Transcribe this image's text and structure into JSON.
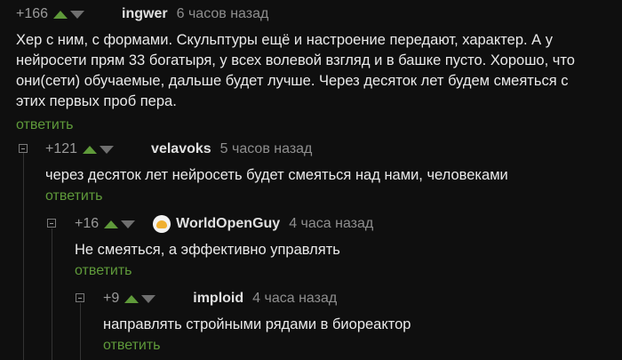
{
  "comments": [
    {
      "rating": "+166",
      "author": "ingwer",
      "time": "6 часов назад",
      "text": "Хер с ним, с формами. Скульптуры ещё и настроение передают, характер. А у нейросети прям 33 богатыря, у всех волевой взгляд и в башке пусто. Хорошо, что они(сети) обучаемые, дальше будет лучше. Через десяток лет будем смеяться с этих первых проб пера.",
      "reply": "ответить"
    },
    {
      "rating": "+121",
      "author": "velavoks",
      "time": "5 часов назад",
      "text": "через десяток лет нейросеть будет смеяться над нами, человеками",
      "reply": "ответить"
    },
    {
      "rating": "+16",
      "author": "WorldOpenGuy",
      "time": "4 часа назад",
      "text": "Не смеяться, а эффективно управлять",
      "reply": "ответить"
    },
    {
      "rating": "+9",
      "author": "imploid",
      "time": "4 часа назад",
      "text": "направлять стройными рядами в биореактор",
      "reply": "ответить"
    }
  ],
  "colors": {
    "upvote": "#5f9a3a",
    "downvote": "#6f6f6f",
    "reply": "#5f9a3a",
    "background": "#0f0f0f"
  }
}
